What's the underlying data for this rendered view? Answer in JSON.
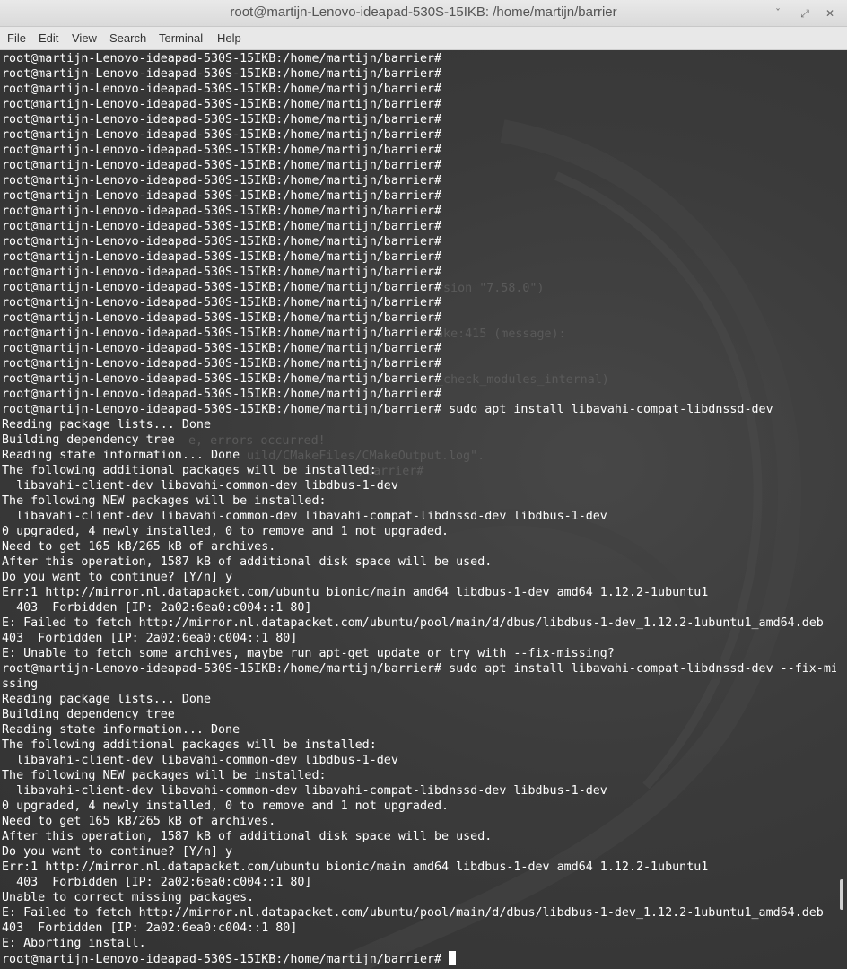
{
  "window": {
    "title": "root@martijn-Lenovo-ideapad-530S-15IKB: /home/martijn/barrier",
    "minimize_glyph": "ˇ",
    "maximize_glyph": "⤢",
    "close_glyph": "✕"
  },
  "menu": {
    "items": [
      "File",
      "Edit",
      "View",
      "Search",
      "Terminal",
      "Help"
    ]
  },
  "background_ghost_text": {
    "g1": "rsion \"7.58.0\")",
    "g2": "ake:415 (message):",
    "g3": "_check_modules_internal)",
    "g4": "e, errors occurred!",
    "g5": "uild/CMakeFiles/CMakeOutput.log\".",
    "g6": "/barrier# "
  },
  "terminal": {
    "lines": [
      "root@martijn-Lenovo-ideapad-530S-15IKB:/home/martijn/barrier#",
      "root@martijn-Lenovo-ideapad-530S-15IKB:/home/martijn/barrier#",
      "root@martijn-Lenovo-ideapad-530S-15IKB:/home/martijn/barrier#",
      "root@martijn-Lenovo-ideapad-530S-15IKB:/home/martijn/barrier#",
      "root@martijn-Lenovo-ideapad-530S-15IKB:/home/martijn/barrier#",
      "root@martijn-Lenovo-ideapad-530S-15IKB:/home/martijn/barrier#",
      "root@martijn-Lenovo-ideapad-530S-15IKB:/home/martijn/barrier#",
      "root@martijn-Lenovo-ideapad-530S-15IKB:/home/martijn/barrier#",
      "root@martijn-Lenovo-ideapad-530S-15IKB:/home/martijn/barrier#",
      "root@martijn-Lenovo-ideapad-530S-15IKB:/home/martijn/barrier#",
      "root@martijn-Lenovo-ideapad-530S-15IKB:/home/martijn/barrier#",
      "root@martijn-Lenovo-ideapad-530S-15IKB:/home/martijn/barrier#",
      "root@martijn-Lenovo-ideapad-530S-15IKB:/home/martijn/barrier#",
      "root@martijn-Lenovo-ideapad-530S-15IKB:/home/martijn/barrier#",
      "root@martijn-Lenovo-ideapad-530S-15IKB:/home/martijn/barrier#",
      "root@martijn-Lenovo-ideapad-530S-15IKB:/home/martijn/barrier#",
      "root@martijn-Lenovo-ideapad-530S-15IKB:/home/martijn/barrier#",
      "root@martijn-Lenovo-ideapad-530S-15IKB:/home/martijn/barrier#",
      "root@martijn-Lenovo-ideapad-530S-15IKB:/home/martijn/barrier#",
      "root@martijn-Lenovo-ideapad-530S-15IKB:/home/martijn/barrier#",
      "root@martijn-Lenovo-ideapad-530S-15IKB:/home/martijn/barrier#",
      "root@martijn-Lenovo-ideapad-530S-15IKB:/home/martijn/barrier#",
      "root@martijn-Lenovo-ideapad-530S-15IKB:/home/martijn/barrier#",
      "root@martijn-Lenovo-ideapad-530S-15IKB:/home/martijn/barrier# sudo apt install libavahi-compat-libdnssd-dev",
      "Reading package lists... Done",
      "Building dependency tree",
      "Reading state information... Done",
      "The following additional packages will be installed:",
      "  libavahi-client-dev libavahi-common-dev libdbus-1-dev",
      "The following NEW packages will be installed:",
      "  libavahi-client-dev libavahi-common-dev libavahi-compat-libdnssd-dev libdbus-1-dev",
      "0 upgraded, 4 newly installed, 0 to remove and 1 not upgraded.",
      "Need to get 165 kB/265 kB of archives.",
      "After this operation, 1587 kB of additional disk space will be used.",
      "Do you want to continue? [Y/n] y",
      "Err:1 http://mirror.nl.datapacket.com/ubuntu bionic/main amd64 libdbus-1-dev amd64 1.12.2-1ubuntu1",
      "  403  Forbidden [IP: 2a02:6ea0:c004::1 80]",
      "E: Failed to fetch http://mirror.nl.datapacket.com/ubuntu/pool/main/d/dbus/libdbus-1-dev_1.12.2-1ubuntu1_amd64.deb",
      "403  Forbidden [IP: 2a02:6ea0:c004::1 80]",
      "E: Unable to fetch some archives, maybe run apt-get update or try with --fix-missing?",
      "root@martijn-Lenovo-ideapad-530S-15IKB:/home/martijn/barrier# sudo apt install libavahi-compat-libdnssd-dev --fix-mi",
      "ssing",
      "Reading package lists... Done",
      "Building dependency tree",
      "Reading state information... Done",
      "The following additional packages will be installed:",
      "  libavahi-client-dev libavahi-common-dev libdbus-1-dev",
      "The following NEW packages will be installed:",
      "  libavahi-client-dev libavahi-common-dev libavahi-compat-libdnssd-dev libdbus-1-dev",
      "0 upgraded, 4 newly installed, 0 to remove and 1 not upgraded.",
      "Need to get 165 kB/265 kB of archives.",
      "After this operation, 1587 kB of additional disk space will be used.",
      "Do you want to continue? [Y/n] y",
      "Err:1 http://mirror.nl.datapacket.com/ubuntu bionic/main amd64 libdbus-1-dev amd64 1.12.2-1ubuntu1",
      "  403  Forbidden [IP: 2a02:6ea0:c004::1 80]",
      "Unable to correct missing packages.",
      "E: Failed to fetch http://mirror.nl.datapacket.com/ubuntu/pool/main/d/dbus/libdbus-1-dev_1.12.2-1ubuntu1_amd64.deb",
      "403  Forbidden [IP: 2a02:6ea0:c004::1 80]",
      "E: Aborting install."
    ],
    "final_prompt": "root@martijn-Lenovo-ideapad-530S-15IKB:/home/martijn/barrier# "
  },
  "colors": {
    "terminal_bg": "#3a3a3a",
    "terminal_fg": "#ffffff",
    "titlebar_bg": "#e4e4e4"
  }
}
